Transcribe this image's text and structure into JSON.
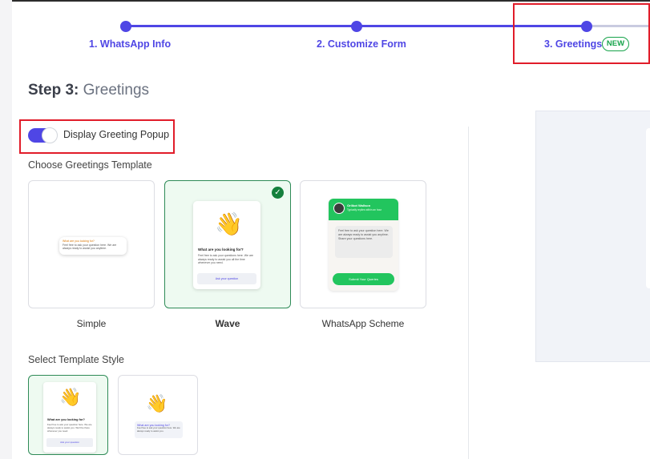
{
  "stepper": {
    "steps": [
      {
        "label": "1. WhatsApp Info"
      },
      {
        "label": "2. Customize Form"
      },
      {
        "label": "3. Greetings",
        "badge": "NEW"
      }
    ]
  },
  "heading": {
    "prefix": "Step 3:",
    "title": "Greetings"
  },
  "toggle": {
    "label": "Display Greeting Popup",
    "enabled": true
  },
  "templates": {
    "section_label": "Choose Greetings Template",
    "items": [
      {
        "name": "Simple",
        "selected": false
      },
      {
        "name": "Wave",
        "selected": true
      },
      {
        "name": "WhatsApp Scheme",
        "selected": false
      }
    ],
    "simple_preview": {
      "line1": "What are you looking for?",
      "line2": "Feel free to ask your question here. We are always ready to assist you anytime."
    },
    "wave_preview": {
      "question": "What are you looking for?",
      "text": "Feel free to ask your questions here. We are always ready to assist you all the time whenever you need.",
      "button": "Ask your question"
    },
    "whatsapp_preview": {
      "name": "Orlikot Wallson",
      "subtitle": "Typically replies within an hour",
      "message": "Feel free to ask your question here. We are always ready to assist you anytime. Share your questions here.",
      "button": "Submit Your Queries"
    }
  },
  "styles": {
    "section_label": "Select Template Style",
    "items": [
      {
        "id": "style-1",
        "selected": true
      },
      {
        "id": "style-2",
        "selected": false
      }
    ],
    "style1_preview": {
      "question": "What are you looking for?",
      "text": "Feel free to ask your question here. We are always ready to assist you. We'll be there whenever you need.",
      "button": "Ask your question"
    },
    "style2_preview": {
      "question": "What are you looking for?",
      "text": "Feel free to ask your question here. We are always ready to assist you."
    }
  },
  "colors": {
    "accent": "#4f46e5",
    "selected_border": "#2e8b57",
    "whatsapp_green": "#22c55e",
    "highlight": "#e11d2a"
  }
}
